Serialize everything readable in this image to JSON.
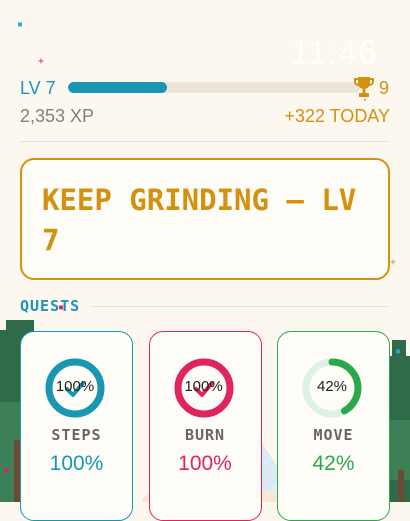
{
  "status_bar": {
    "time": "11:46"
  },
  "level": {
    "label": "LV 7",
    "progress": 0.34,
    "trophy_count": "9",
    "xp_total": "2,353 XP",
    "xp_today": "+322 TODAY"
  },
  "motivation": {
    "text": "KEEP GRINDING — LV 7"
  },
  "quests_section": {
    "label": "QUESTS",
    "items": [
      {
        "name": "STEPS",
        "ring_label": "100%",
        "value_label": "100%",
        "progress": 1.0,
        "color": "#1996b2",
        "track_color": "#dcefF3"
      },
      {
        "name": "BURN",
        "ring_label": "100%",
        "value_label": "100%",
        "progress": 1.0,
        "color": "#e0245e",
        "track_color": "#f9dde5"
      },
      {
        "name": "MOVE",
        "ring_label": "42%",
        "value_label": "42%",
        "progress": 0.42,
        "color": "#2aa84a",
        "track_color": "#def2e3"
      }
    ]
  },
  "colors": {
    "accent_blue": "#1996b2",
    "accent_gold": "#d4900f",
    "accent_pink": "#e0245e",
    "accent_green": "#2aa84a",
    "background": "#fdf8ef"
  },
  "icons": {
    "trophy": "trophy-icon",
    "check": "check-icon"
  }
}
